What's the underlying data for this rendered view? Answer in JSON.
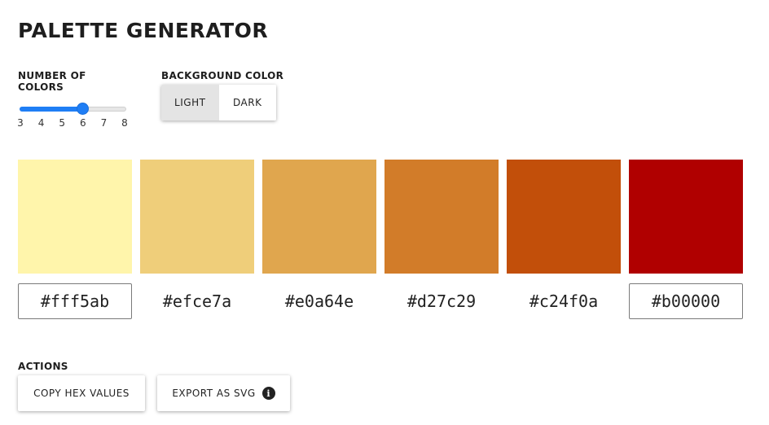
{
  "header": {
    "title": "PALETTE GENERATOR"
  },
  "number_of_colors": {
    "label": "NUMBER OF COLORS",
    "min": 3,
    "max": 8,
    "value": 6,
    "ticks": [
      "3",
      "4",
      "5",
      "6",
      "7",
      "8"
    ],
    "accent_color": "#1f7ef5"
  },
  "background_color": {
    "label": "BACKGROUND COLOR",
    "options": [
      "LIGHT",
      "DARK"
    ],
    "selected": "LIGHT"
  },
  "palette": {
    "colors": [
      {
        "hex": "#fff5ab",
        "focused": true
      },
      {
        "hex": "#efce7a",
        "focused": false
      },
      {
        "hex": "#e0a64e",
        "focused": false
      },
      {
        "hex": "#d27c29",
        "focused": false
      },
      {
        "hex": "#c24f0a",
        "focused": false
      },
      {
        "hex": "#b00000",
        "focused": true
      }
    ]
  },
  "actions": {
    "label": "ACTIONS",
    "copy_label": "COPY HEX VALUES",
    "export_label": "EXPORT AS SVG",
    "export_icon": "info-icon"
  }
}
